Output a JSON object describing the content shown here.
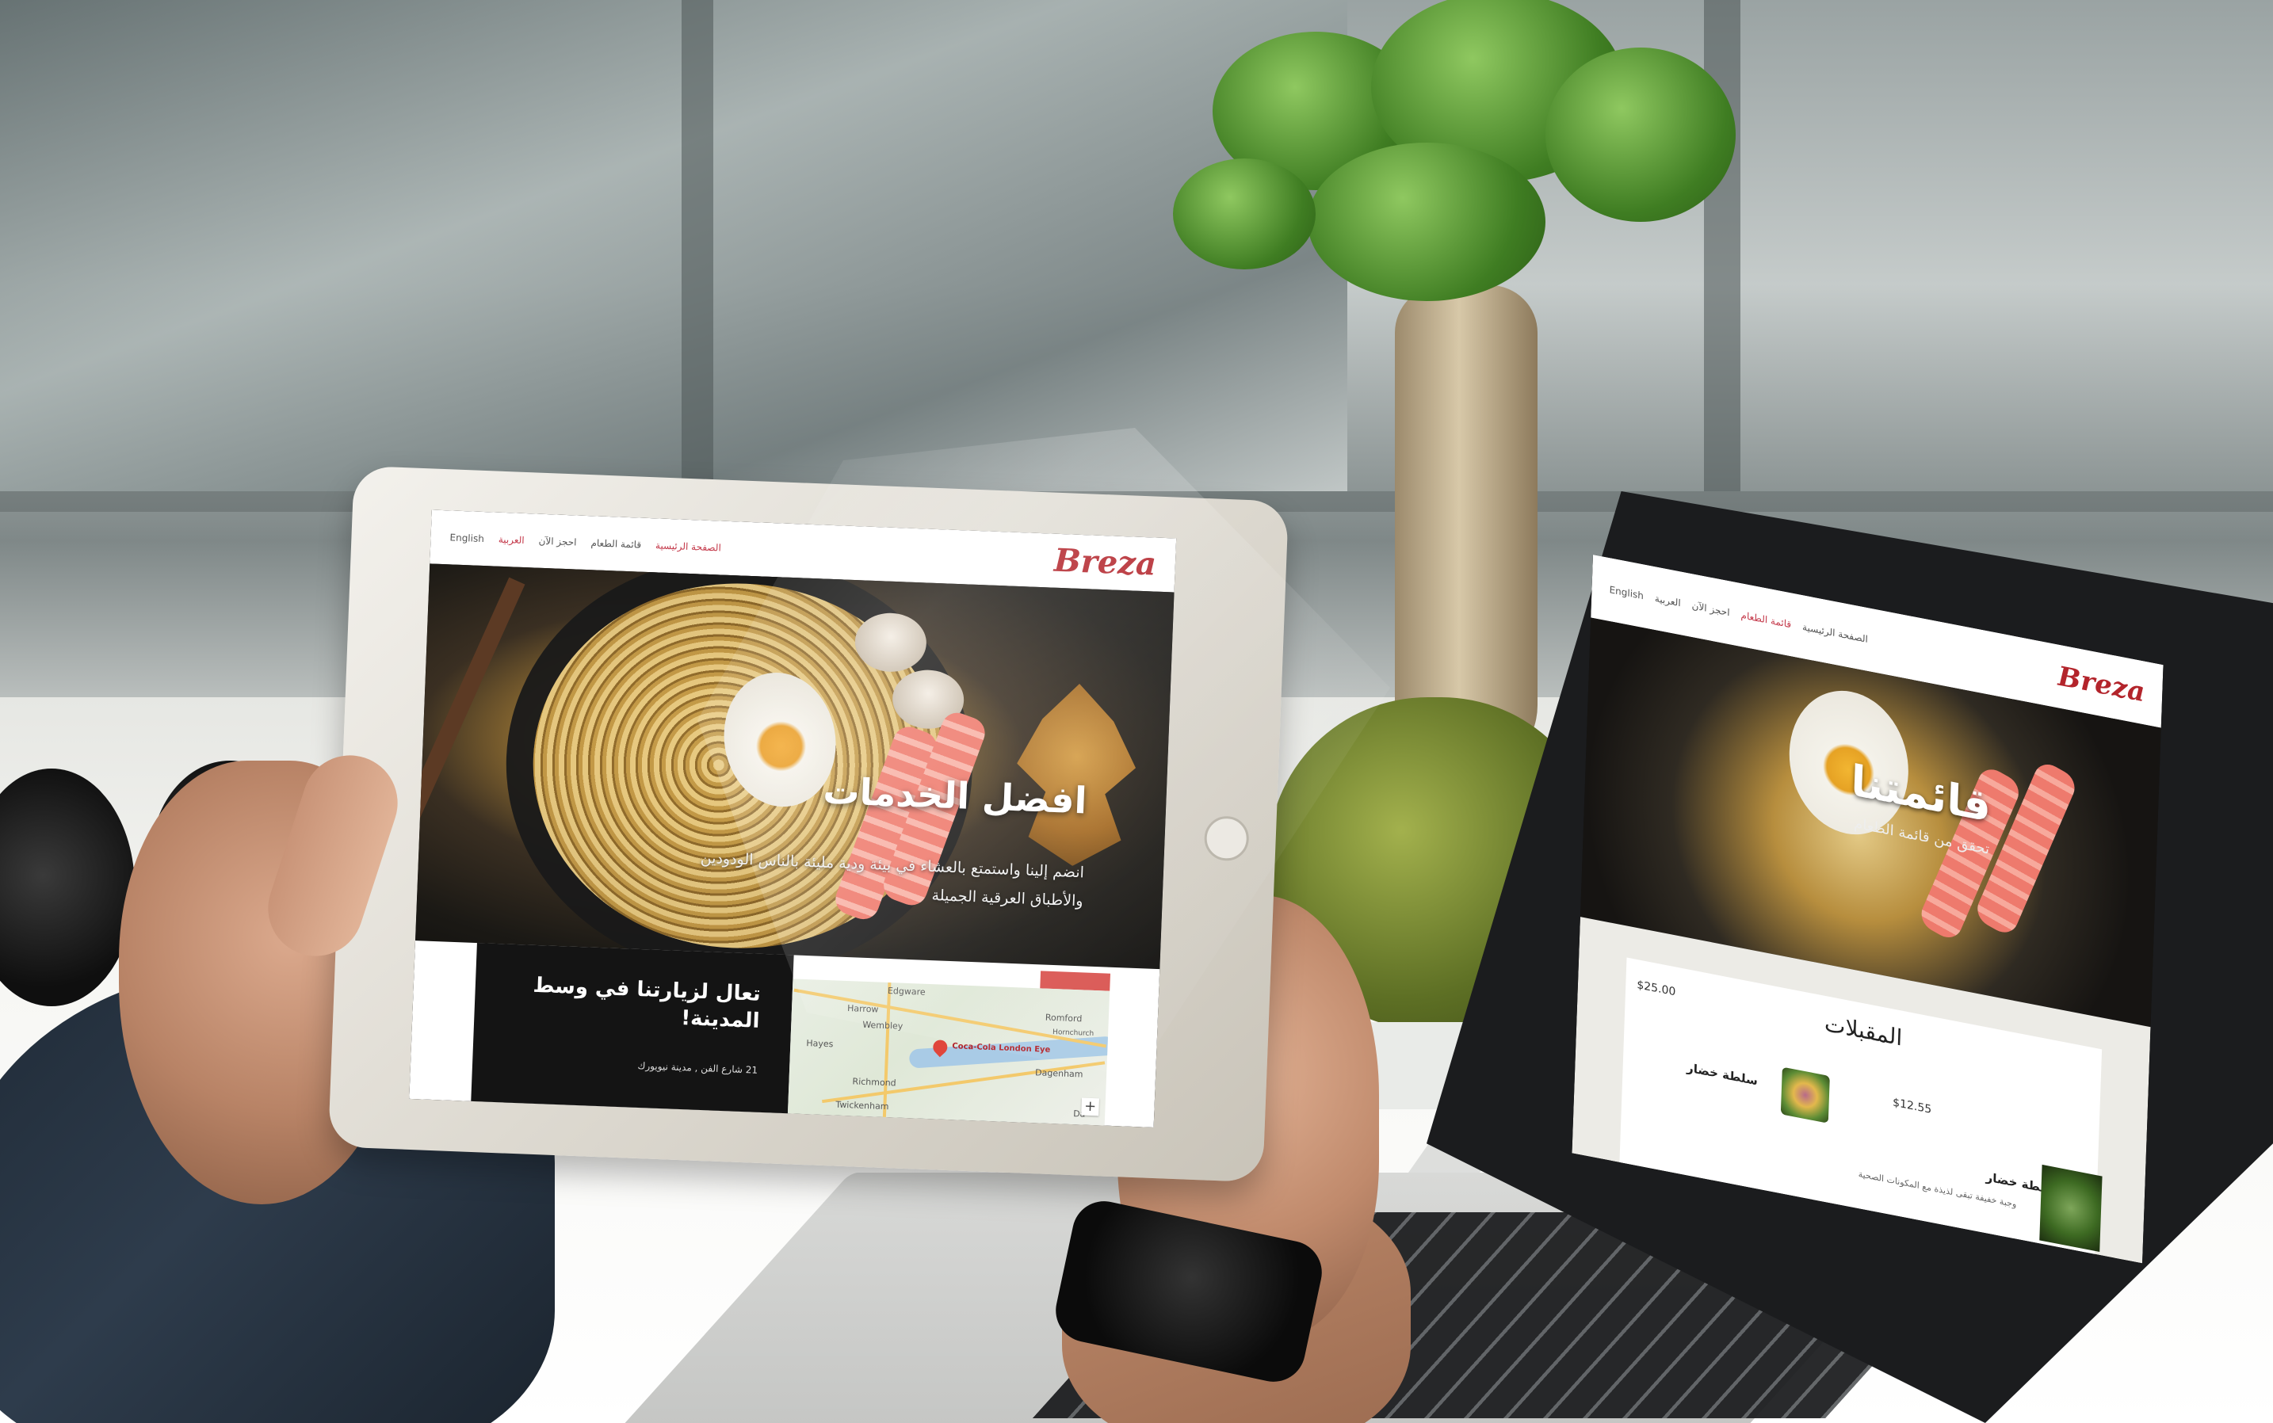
{
  "colors": {
    "brand_red": "#b3242b",
    "active_link": "#c4394a",
    "info_dark": "#141414",
    "menu_bg": "#ecebe6"
  },
  "tablet": {
    "logo": "Breza",
    "nav": {
      "home": "الصفحة الرئيسية",
      "menu": "قائمة الطعام",
      "book": "احجز الآن",
      "lang_ar": "العربية",
      "lang_en": "English"
    },
    "hero": {
      "title": "افضل الخدمات",
      "text": "انضم إلينا واستمتع بالعشاء في بيئة ودية مليئة بالناس الودودين والأطباق العرقية الجميلة"
    },
    "info": {
      "title": "تعال لزيارتنا في وسط المدينة!",
      "address": "21 شارع الفن , مدينة نيويورك"
    },
    "map": {
      "places": [
        "Edgware",
        "Harrow",
        "Wembley",
        "Romford",
        "Hayes",
        "Dagenham",
        "Richmond",
        "Twickenham",
        "Hornchurch",
        "Da"
      ],
      "pin_label": "Coca-Cola London Eye",
      "zoom_in": "+"
    }
  },
  "laptop": {
    "logo": "Breza",
    "nav": {
      "home": "الصفحة الرئيسية",
      "menu": "قائمة الطعام",
      "book": "احجز الآن",
      "lang_ar": "العربية",
      "lang_en": "English"
    },
    "hero": {
      "title": "قائمتنا",
      "subtitle": "تحقق من قائمة الطعام"
    },
    "menu_section": {
      "title": "المقبلات",
      "section_price": "$25.00",
      "items": [
        {
          "name": "سلطة خضار",
          "price": "$12.55"
        },
        {
          "name": "سلطة خضار",
          "description": "وجبة خفيفة تبقى لذيذة مع المكونات الصحية"
        }
      ]
    }
  }
}
